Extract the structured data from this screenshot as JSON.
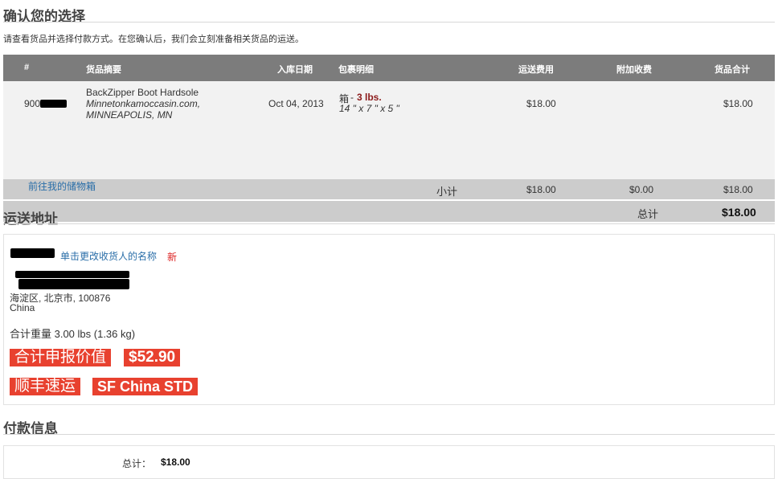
{
  "confirm": {
    "title": "确认您的选择",
    "intro": "请查看货品并选择付款方式。在您确认后，我们会立刻准备相关货品的运送。"
  },
  "table": {
    "headers": [
      "#",
      "货品摘要",
      "入库日期",
      "包裹明细",
      "运送费用",
      "附加收费",
      "货品合计"
    ],
    "row": {
      "id_prefix": "900",
      "item_name": "BackZipper Boot Hardsole",
      "item_store": "Minnetonkamoccasin.com,",
      "item_city": "MINNEAPOLIS, MN",
      "date": "Oct 04, 2013",
      "pkg_type": "箱",
      "pkg_weight": "3 lbs.",
      "pkg_dims": "14 \" x 7 \" x 5 \"",
      "shipping": "$18.00",
      "total": "$18.00"
    },
    "subtotal": {
      "label": "小计",
      "shipping": "$18.00",
      "extra": "$0.00",
      "total": "$18.00"
    },
    "grand": {
      "label": "总计",
      "value": "$18.00"
    }
  },
  "storage_link": "前往我的储物箱",
  "shipping_address": {
    "title": "运送地址",
    "change_link": "单击更改收货人的名称",
    "new_tag": "新",
    "line3": "海淀区, 北京市, 100876",
    "country": "China",
    "weight": "合计重量 3.00 lbs (1.36 kg)",
    "declared_label": "合计申报价值",
    "declared_value": "$52.90",
    "carrier_cn": "顺丰速运",
    "carrier_en": "SF China STD"
  },
  "payment": {
    "title": "付款信息",
    "total_label": "总计：",
    "total_value": "$18.00"
  }
}
